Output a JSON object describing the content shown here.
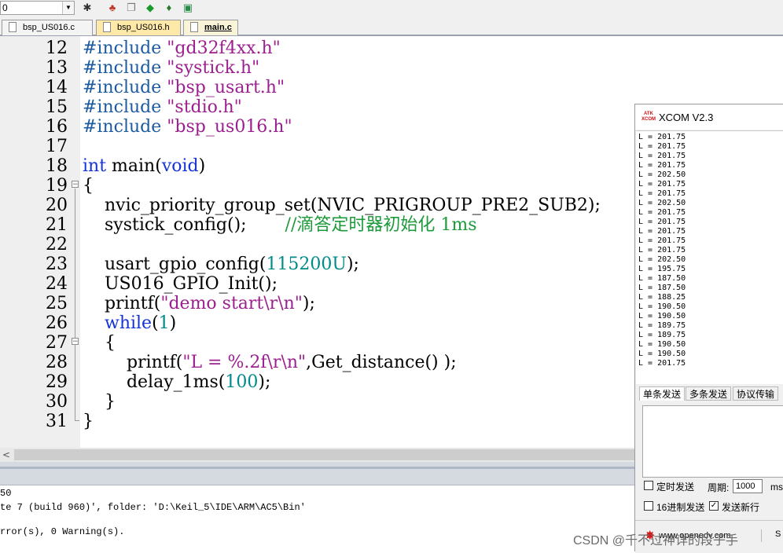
{
  "toolbar": {
    "combo_value": "0",
    "icons": [
      "build-target-icon",
      "hierarchy-icon",
      "copy-icon",
      "diamond-icon",
      "flash-icon",
      "package-icon"
    ]
  },
  "tabs": [
    {
      "label": "bsp_US016.c",
      "active": false
    },
    {
      "label": "bsp_US016.h",
      "active": false
    },
    {
      "label": "main.c",
      "active": true
    }
  ],
  "editor": {
    "lines": [
      {
        "n": "12",
        "text": "#include \"gd32f4xx.h\""
      },
      {
        "n": "13",
        "text": "#include \"systick.h\""
      },
      {
        "n": "14",
        "text": "#include \"bsp_usart.h\""
      },
      {
        "n": "15",
        "text": "#include \"stdio.h\""
      },
      {
        "n": "16",
        "text": "#include \"bsp_us016.h\""
      },
      {
        "n": "17",
        "text": ""
      },
      {
        "n": "18",
        "text": "int main(void)"
      },
      {
        "n": "19",
        "text": "{"
      },
      {
        "n": "20",
        "text": "    nvic_priority_group_set(NVIC_PRIGROUP_PRE2_SUB2);"
      },
      {
        "n": "21",
        "text": "    systick_config();       //滴答定时器初始化 1ms"
      },
      {
        "n": "22",
        "text": ""
      },
      {
        "n": "23",
        "text": "    usart_gpio_config(115200U);"
      },
      {
        "n": "24",
        "text": "    US016_GPIO_Init();"
      },
      {
        "n": "25",
        "text": "    printf(\"demo start\\r\\n\");"
      },
      {
        "n": "26",
        "text": "    while(1)"
      },
      {
        "n": "27",
        "text": "    {"
      },
      {
        "n": "28",
        "text": "        printf(\"L = %.2f\\r\\n\",Get_distance() );"
      },
      {
        "n": "29",
        "text": "        delay_1ms(100);"
      },
      {
        "n": "30",
        "text": "    }"
      },
      {
        "n": "31",
        "text": "}"
      }
    ],
    "colors": {
      "preprocessor": "#1d5ba0",
      "string": "#9b1f8e",
      "keyword": "#1533d6",
      "number": "#008a8a",
      "comment": "#1d9a3a"
    }
  },
  "output": {
    "lines": [
      "50",
      "te 7 (build 960)', folder: 'D:\\Keil_5\\IDE\\ARM\\AC5\\Bin'",
      "",
      "rror(s), 0 Warning(s)."
    ]
  },
  "xcom": {
    "title": "XCOM V2.3",
    "logo": "ATK XCOM",
    "received": [
      "L = 201.75",
      "L = 201.75",
      "L = 201.75",
      "L = 201.75",
      "L = 202.50",
      "L = 201.75",
      "L = 201.75",
      "L = 202.50",
      "L = 201.75",
      "L = 201.75",
      "L = 201.75",
      "L = 201.75",
      "L = 201.75",
      "L = 202.50",
      "L = 195.75",
      "L = 187.50",
      "L = 187.50",
      "L = 188.25",
      "L = 190.50",
      "L = 190.50",
      "L = 189.75",
      "L = 189.75",
      "L = 190.50",
      "L = 190.50",
      "L = 201.75"
    ],
    "tabs": [
      "单条发送",
      "多条发送",
      "协议传输"
    ],
    "timed_send_label": "定时发送",
    "period_label": "周期:",
    "period_value": "1000",
    "period_unit": "ms",
    "hex_send_label": "16进制发送",
    "newline_label": "发送新行",
    "timed_send_checked": false,
    "hex_send_checked": false,
    "newline_checked": true,
    "url": "www.openedv.com",
    "footer_s": "S"
  },
  "watermark": "CSDN @千不过神详的段子手"
}
